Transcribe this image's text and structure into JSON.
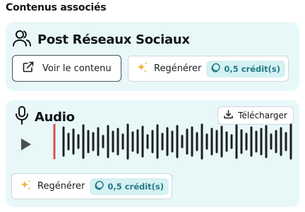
{
  "section": {
    "title": "Contenus associés"
  },
  "post": {
    "icon": "users-icon",
    "title": "Post Réseaux Sociaux",
    "view_label": "Voir le contenu",
    "regenerate_label": "Regénérer",
    "credit_label": "0,5 crédit(s)"
  },
  "audio": {
    "icon": "microphone-icon",
    "title": "Audio",
    "download_label": "Télécharger",
    "player": {
      "play_icon": "play-icon",
      "progress": 0.0
    },
    "regenerate_label": "Regénérer",
    "credit_label": "0,5 crédit(s)"
  },
  "colors": {
    "card_bg": "#e8f8f9",
    "credit_bg": "#d4f1f3",
    "credit_text": "#247a86",
    "playhead": "#d9534f",
    "waveform": "#1b1e22"
  }
}
